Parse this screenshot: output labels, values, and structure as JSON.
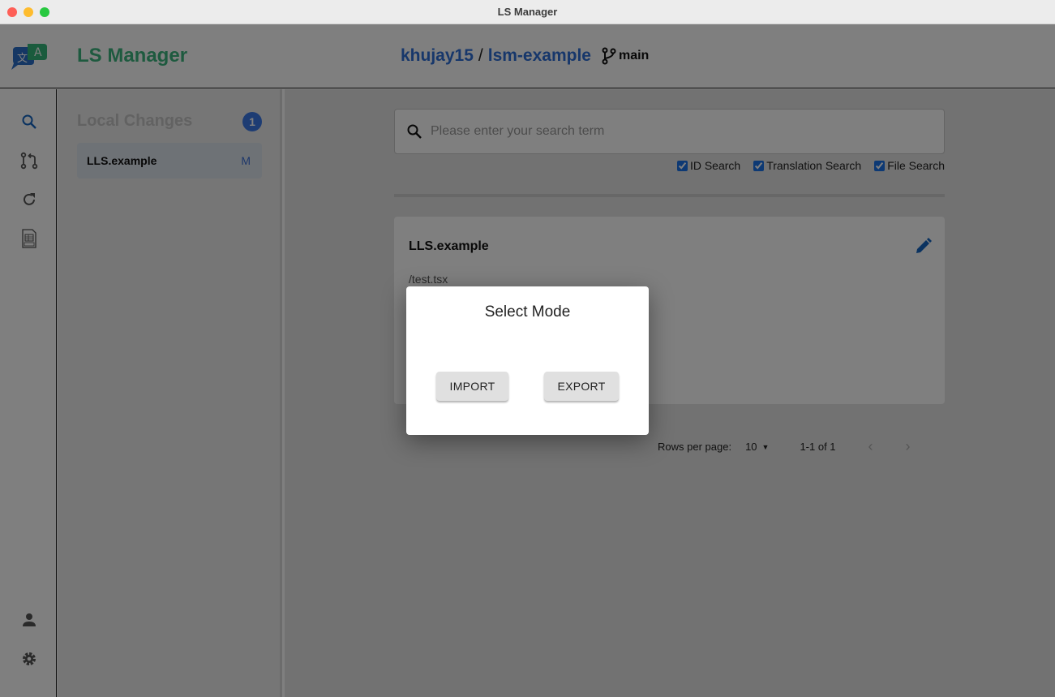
{
  "window": {
    "title": "LS Manager"
  },
  "header": {
    "app_name": "LS Manager",
    "owner": "khujay15",
    "separator": "/",
    "repo": "lsm-example",
    "branch": "main"
  },
  "sidebar": {
    "items": [
      {
        "icon": "search-icon",
        "active": true
      },
      {
        "icon": "pull-request-icon"
      },
      {
        "icon": "refresh-icon"
      },
      {
        "icon": "xls-file-icon"
      }
    ],
    "bottom": [
      {
        "icon": "person-icon"
      },
      {
        "icon": "gear-icon"
      }
    ]
  },
  "local_changes": {
    "title": "Local Changes",
    "count": "1",
    "items": [
      {
        "name": "LLS.example",
        "status": "M"
      }
    ]
  },
  "search": {
    "placeholder": "Please enter your search term",
    "options": [
      {
        "label": "ID Search",
        "checked": true
      },
      {
        "label": "Translation Search",
        "checked": true
      },
      {
        "label": "File Search",
        "checked": true
      }
    ]
  },
  "card": {
    "title": "LLS.example",
    "path": "/test.tsx"
  },
  "pagination": {
    "rows_label": "Rows per page:",
    "rows_value": "10",
    "range": "1-1 of 1"
  },
  "dialog": {
    "title": "Select Mode",
    "import_label": "IMPORT",
    "export_label": "EXPORT"
  },
  "colors": {
    "brand": "#3cb57f",
    "accent": "#2f6fd6",
    "overlay": "rgba(0,0,0,0.5)"
  }
}
